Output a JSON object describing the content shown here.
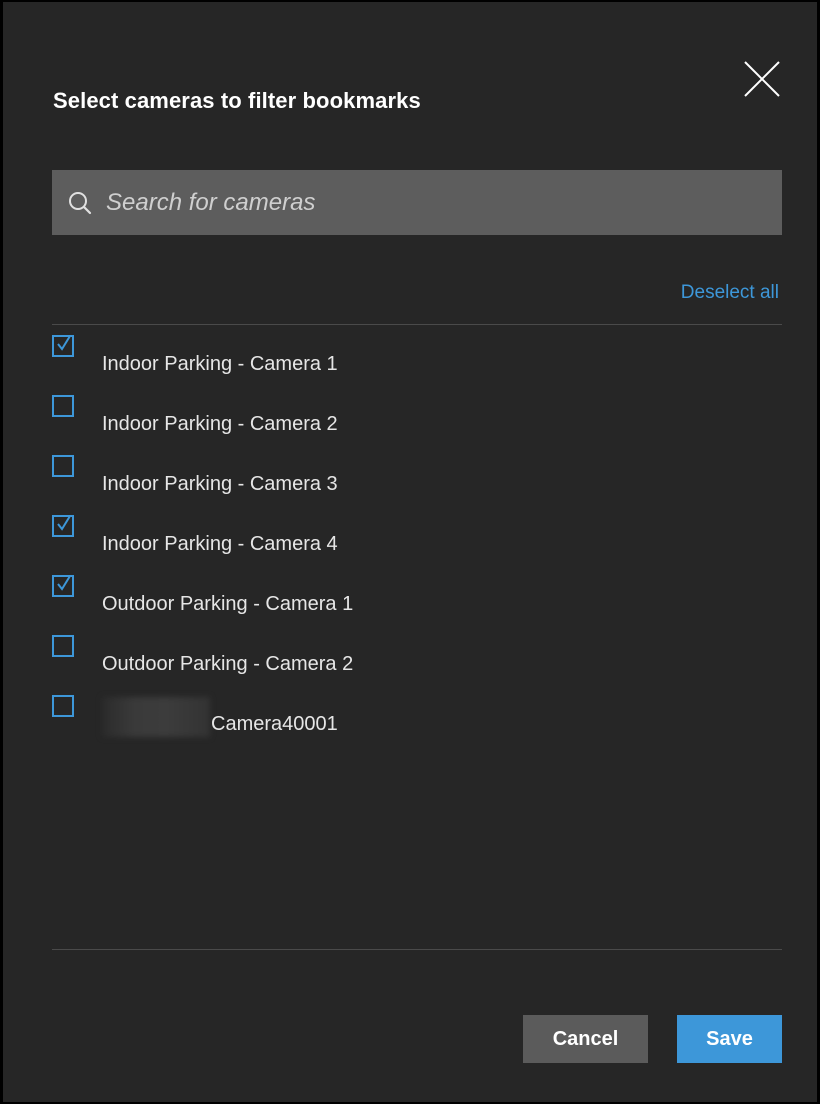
{
  "dialog": {
    "title": "Select cameras to filter bookmarks",
    "close_icon": "close-icon"
  },
  "search": {
    "placeholder": "Search for cameras",
    "value": "",
    "icon": "search-icon"
  },
  "deselect_all_label": "Deselect all",
  "cameras": [
    {
      "label": "Indoor Parking - Camera 1",
      "checked": true
    },
    {
      "label": "Indoor Parking - Camera 2",
      "checked": false
    },
    {
      "label": "Indoor Parking - Camera 3",
      "checked": false
    },
    {
      "label": "Indoor Parking - Camera 4",
      "checked": true
    },
    {
      "label": "Outdoor Parking - Camera 1",
      "checked": true
    },
    {
      "label": "Outdoor Parking - Camera 2",
      "checked": false
    },
    {
      "label": "Camera40001",
      "checked": false,
      "redacted_prefix": true
    }
  ],
  "buttons": {
    "cancel_label": "Cancel",
    "save_label": "Save"
  },
  "colors": {
    "accent": "#3d97d9",
    "background": "#262626",
    "search_background": "#5d5d5d",
    "cancel_background": "#5b5b5b"
  }
}
